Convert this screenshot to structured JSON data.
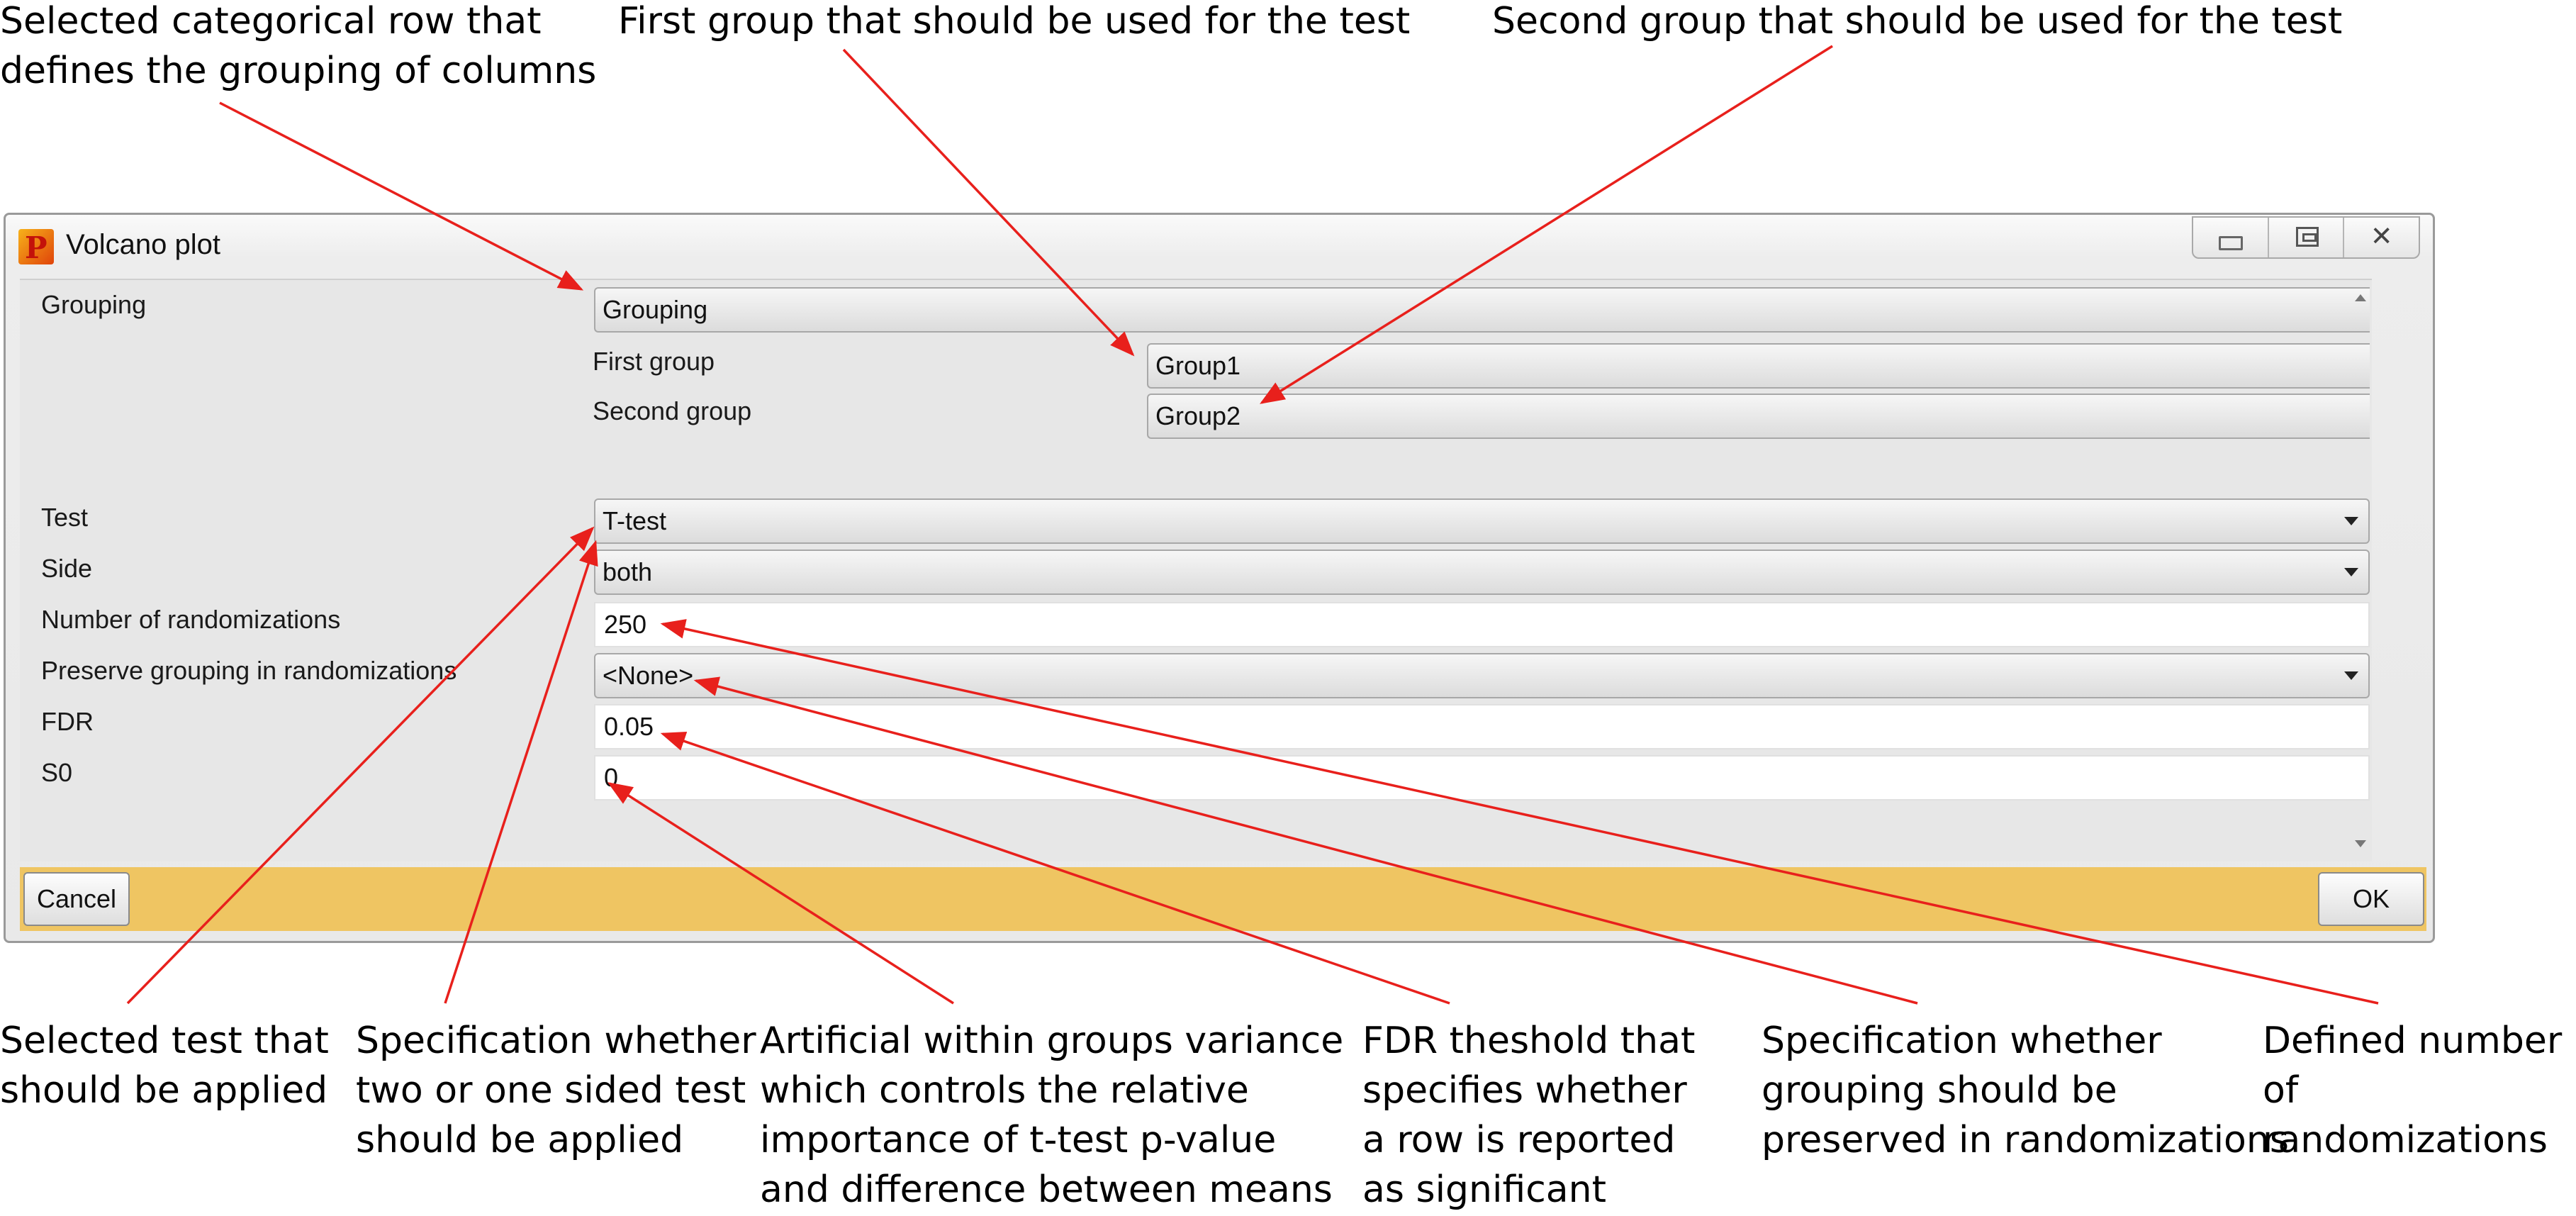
{
  "window": {
    "title": "Volcano plot",
    "icon": "perseus-p-icon"
  },
  "form": {
    "grouping": {
      "label": "Grouping",
      "value": "Grouping"
    },
    "first_group": {
      "label": "First group",
      "value": "Group1"
    },
    "second_group": {
      "label": "Second group",
      "value": "Group2"
    },
    "test": {
      "label": "Test",
      "value": "T-test"
    },
    "side": {
      "label": "Side",
      "value": "both"
    },
    "randomizations": {
      "label": "Number of randomizations",
      "value": "250"
    },
    "preserve_grouping": {
      "label": "Preserve grouping in randomizations",
      "value": "<None>"
    },
    "fdr": {
      "label": "FDR",
      "value": "0.05"
    },
    "s0": {
      "label": "S0",
      "value": "0"
    }
  },
  "buttons": {
    "cancel": "Cancel",
    "ok": "OK"
  },
  "annotations": {
    "grouping_row": "Selected categorical row that\ndefines the grouping of columns",
    "first_group": "First group that should be used for the test",
    "second_group": "Second group that should be used for the test",
    "test": "Selected test that\nshould be applied",
    "side": "Specification whether\ntwo or one sided test\nshould be applied",
    "s0": "Artificial within groups variance\nwhich controls the relative\nimportance of t-test p-value\nand difference between means",
    "fdr": "FDR theshold that\nspecifies whether\na row is reported\nas significant",
    "preserve": "Specification whether\ngrouping should be\npreserved in randomizations",
    "randomizations": "Defined number\nof randomizations"
  },
  "colors": {
    "arrow": "#e8201c",
    "footer_bar": "#efc562"
  }
}
